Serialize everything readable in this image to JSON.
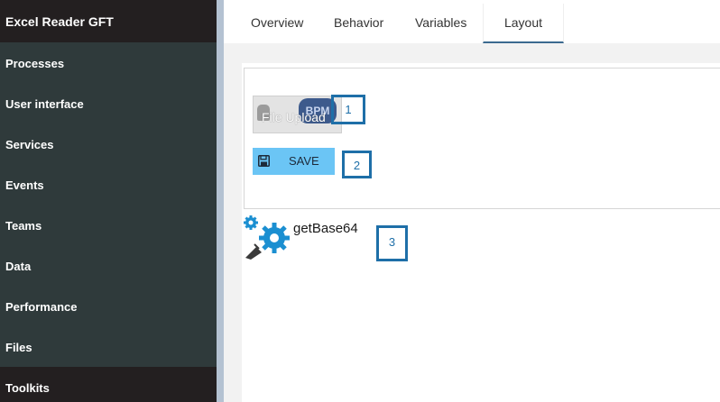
{
  "sidebar": {
    "app_title": "Excel Reader GFT",
    "items": [
      {
        "label": "Processes"
      },
      {
        "label": "User interface"
      },
      {
        "label": "Services"
      },
      {
        "label": "Events"
      },
      {
        "label": "Teams"
      },
      {
        "label": "Data"
      },
      {
        "label": "Performance"
      },
      {
        "label": "Files"
      },
      {
        "label": "Toolkits"
      }
    ]
  },
  "tabs": [
    {
      "label": "Overview"
    },
    {
      "label": "Behavior"
    },
    {
      "label": "Variables"
    },
    {
      "label": "Layout",
      "active": true
    }
  ],
  "canvas": {
    "file_upload": {
      "label": "File Upload",
      "badge": "BPM"
    },
    "save_button": {
      "label": "SAVE",
      "icon": "floppy-disk-icon"
    },
    "service": {
      "label": "getBase64",
      "icon": "gears-plug-icon"
    }
  },
  "markers": [
    "1",
    "2",
    "3"
  ],
  "colors": {
    "sidebar_bg": "#2f3a3b",
    "sidebar_active": "#231f20",
    "save_button": "#6bc5f5",
    "active_tab_underline": "#3b6a8f",
    "marker": "#1e6fa8",
    "gear": "#1b8fd1"
  }
}
